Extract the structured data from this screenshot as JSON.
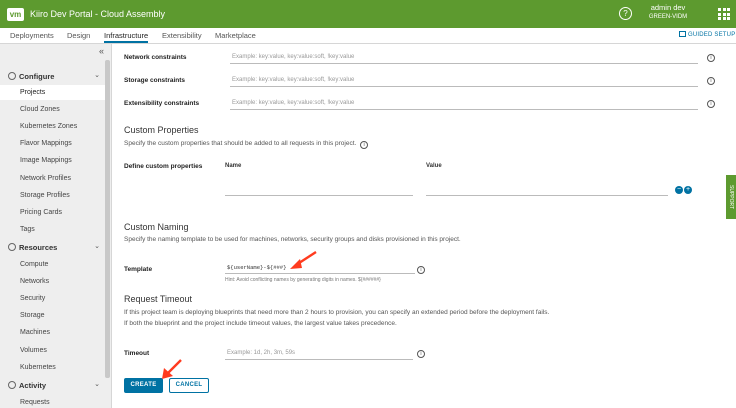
{
  "header": {
    "logo": "vm",
    "title": "Kiiro Dev Portal - Cloud Assembly",
    "user_name": "admin dev",
    "user_org": "GREEN-VIDM"
  },
  "tabs": [
    {
      "label": "Deployments"
    },
    {
      "label": "Design"
    },
    {
      "label": "Infrastructure"
    },
    {
      "label": "Extensibility"
    },
    {
      "label": "Marketplace"
    }
  ],
  "guided_setup": "GUIDED SETUP",
  "sidebar": {
    "collapse": "«",
    "sections": [
      {
        "label": "Configure",
        "items": [
          "Projects",
          "Cloud Zones",
          "Kubernetes Zones",
          "Flavor Mappings",
          "Image Mappings",
          "Network Profiles",
          "Storage Profiles",
          "Pricing Cards",
          "Tags"
        ]
      },
      {
        "label": "Resources",
        "items": [
          "Compute",
          "Networks",
          "Security",
          "Storage",
          "Machines",
          "Volumes",
          "Kubernetes"
        ]
      },
      {
        "label": "Activity",
        "items": [
          "Requests"
        ]
      }
    ],
    "active_item": "Projects"
  },
  "form": {
    "network_constraints": {
      "label": "Network constraints",
      "placeholder": "Example: key:value, key:value:soft, !key:value"
    },
    "storage_constraints": {
      "label": "Storage constraints",
      "placeholder": "Example: key:value, key:value:soft, !key:value"
    },
    "extensibility_constraints": {
      "label": "Extensibility constraints",
      "placeholder": "Example: key:value, key:value:soft, !key:value"
    },
    "custom_properties": {
      "title": "Custom Properties",
      "description": "Specify the custom properties that should be added to all requests in this project.",
      "define_label": "Define custom properties",
      "name_col": "Name",
      "value_col": "Value"
    },
    "custom_naming": {
      "title": "Custom Naming",
      "description": "Specify the naming template to be used for machines, networks, security groups and disks provisioned in this project.",
      "template_label": "Template",
      "template_value": "${userName}-${###}",
      "hint": "Hint: Avoid conflicting names by generating digits in names. ${######}"
    },
    "request_timeout": {
      "title": "Request Timeout",
      "description_line1": "If this project team is deploying blueprints that need more than 2 hours to provision, you can specify an extended period before the deployment fails.",
      "description_line2": "If both the blueprint and the project include timeout values, the largest value takes precedence.",
      "timeout_label": "Timeout",
      "timeout_placeholder": "Example: 1d, 2h, 3m, 59s"
    },
    "create_label": "CREATE",
    "cancel_label": "CANCEL"
  },
  "support_label": "SUPPORT",
  "colors": {
    "header": "#5d9a2f",
    "accent": "#0072a3",
    "arrow": "#ff3b1f"
  }
}
